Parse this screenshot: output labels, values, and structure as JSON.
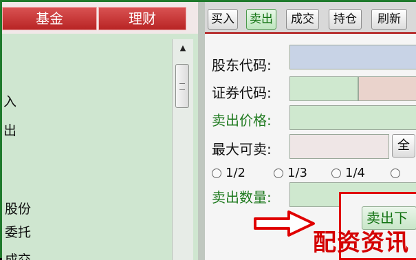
{
  "top_tabs": [
    "基金",
    "理财"
  ],
  "left_panel": {
    "items": [
      "入",
      "出",
      "股份",
      "委托",
      "成交"
    ]
  },
  "toolbar": {
    "buttons": [
      "买入",
      "卖出",
      "成交",
      "持仓",
      "刷新"
    ],
    "active": "卖出"
  },
  "form": {
    "shareholder_code_label": "股东代码:",
    "security_code_label": "证券代码:",
    "sell_price_label": "卖出价格:",
    "max_sellable_label": "最大可卖:",
    "all_button_label": "全",
    "sell_quantity_label": "卖出数量:",
    "ratios": [
      "1/2",
      "1/3",
      "1/4"
    ],
    "submit_label": "卖出下"
  },
  "watermark": "配资资讯",
  "colors": {
    "accent_red": "#d40000",
    "active_green": "#137313",
    "panel_green": "#cfe6d0"
  }
}
